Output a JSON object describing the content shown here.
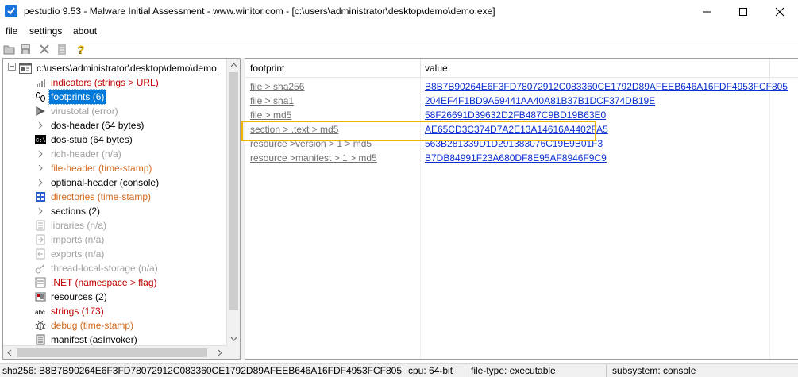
{
  "window": {
    "title": "pestudio 9.53 - Malware Initial Assessment - www.winitor.com - [c:\\users\\administrator\\desktop\\demo\\demo.exe]",
    "icon": "pestudio-check-icon",
    "buttons": [
      "minimize-icon",
      "maximize-icon",
      "close-icon"
    ]
  },
  "menu": {
    "items": [
      "file",
      "settings",
      "about"
    ]
  },
  "toolbar": {
    "buttons": [
      "open-folder-icon",
      "save-icon",
      "delete-icon",
      "clipboard-icon",
      "help-icon"
    ]
  },
  "tree": {
    "root": "c:\\users\\administrator\\desktop\\demo\\demo.",
    "items": [
      {
        "label": "indicators (strings > URL)",
        "color": "#c00000",
        "icon": "bar-chart-icon"
      },
      {
        "label": "footprints (6)",
        "color": "#ffffff",
        "icon": "footprint-icon",
        "selected": true
      },
      {
        "label": "virustotal (error)",
        "color": "#a0a0a0",
        "icon": "virustotal-icon"
      },
      {
        "label": "dos-header (64 bytes)",
        "color": "#000000",
        "icon": "expand-arrow-icon"
      },
      {
        "label": "dos-stub (64 bytes)",
        "color": "#000000",
        "icon": "console-icon"
      },
      {
        "label": "rich-header (n/a)",
        "color": "#a0a0a0",
        "icon": "expand-arrow-icon"
      },
      {
        "label": "file-header (time-stamp)",
        "color": "#d2691e",
        "icon": "expand-arrow-icon"
      },
      {
        "label": "optional-header (console)",
        "color": "#000000",
        "icon": "expand-arrow-icon"
      },
      {
        "label": "directories (time-stamp)",
        "color": "#d2691e",
        "icon": "directories-icon"
      },
      {
        "label": "sections (2)",
        "color": "#000000",
        "icon": "expand-arrow-icon"
      },
      {
        "label": "libraries (n/a)",
        "color": "#a0a0a0",
        "icon": "library-icon"
      },
      {
        "label": "imports (n/a)",
        "color": "#a0a0a0",
        "icon": "imports-icon"
      },
      {
        "label": "exports (n/a)",
        "color": "#a0a0a0",
        "icon": "exports-icon"
      },
      {
        "label": "thread-local-storage (n/a)",
        "color": "#a0a0a0",
        "icon": "tls-icon"
      },
      {
        "label": ".NET (namespace > flag)",
        "color": "#c00000",
        "icon": "dotnet-icon"
      },
      {
        "label": "resources (2)",
        "color": "#000000",
        "icon": "resources-icon"
      },
      {
        "label": "strings (173)",
        "color": "#c00000",
        "icon": "strings-abc-icon"
      },
      {
        "label": "debug (time-stamp)",
        "color": "#d2691e",
        "icon": "debug-bug-icon"
      },
      {
        "label": "manifest (asInvoker)",
        "color": "#000000",
        "icon": "manifest-icon"
      }
    ]
  },
  "list": {
    "columns": [
      "footprint",
      "value"
    ],
    "rows": [
      {
        "footprint": "file > sha256",
        "value": "B8B7B90264E6F3FD78072912C083360CE1792D89AFEEB646A16FDF4953FCF805"
      },
      {
        "footprint": "file > sha1",
        "value": "204EF4F1BD9A59441AA40A81B37B1DCF374DB19E"
      },
      {
        "footprint": "file > md5",
        "value": "58F26691D39632D2FB487C9BD19B63E0"
      },
      {
        "footprint": "section > .text > md5",
        "value": "AE65CD3C374D7A2E13A14616A4402FA5",
        "highlighted": true
      },
      {
        "footprint": "resource >version > 1 > md5",
        "value": "563B281339D1D291383076C19E9B01F3"
      },
      {
        "footprint": "resource >manifest > 1 > md5",
        "value": "B7DB84991F23A680DF8E95AF8946F9C9"
      }
    ]
  },
  "status": {
    "sha256": "sha256: B8B7B90264E6F3FD78072912C083360CE1792D89AFEEB646A16FDF4953FCF805",
    "cpu": "cpu: 64-bit",
    "file_type": "file-type: executable",
    "subsystem": "subsystem: console"
  },
  "colors": {
    "selection": "#0078d7",
    "highlight_box": "#f0b400",
    "link": "#0b2fd1"
  }
}
